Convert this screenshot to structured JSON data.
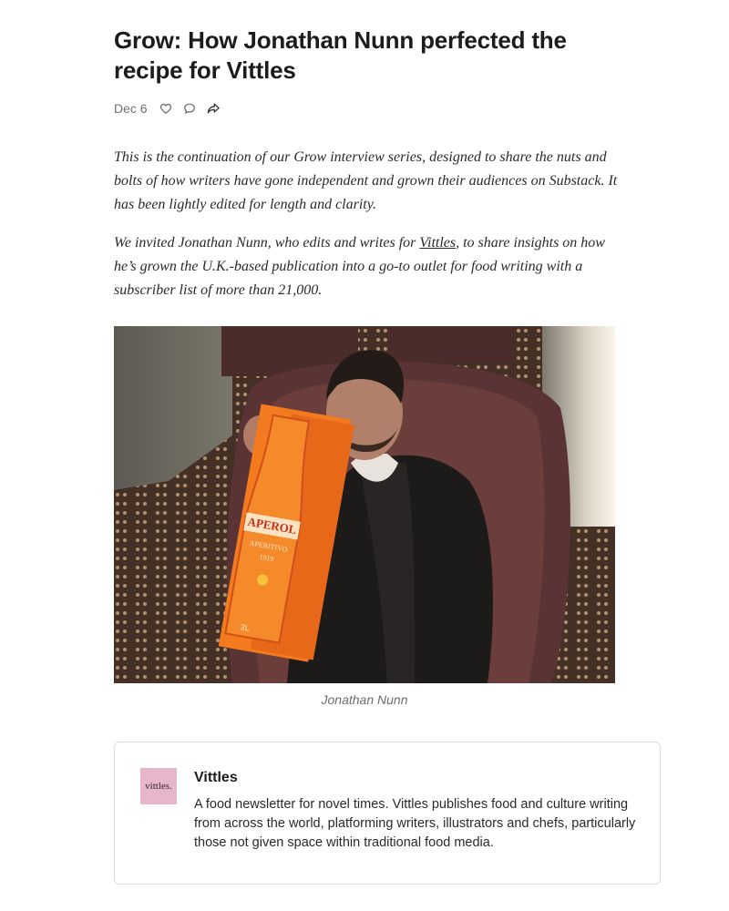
{
  "article": {
    "title": "Grow: How Jonathan Nunn perfected the recipe for Vittles",
    "date": "Dec 6",
    "intro_paragraph_1": "This is the continuation of our Grow interview series, designed to share the nuts and bolts of how writers have gone independent and grown their audiences on Substack. It has been lightly edited for length and clarity.",
    "intro_paragraph_2_before": "We invited Jonathan Nunn, who edits and writes for ",
    "intro_link": "Vittles",
    "intro_paragraph_2_after": ", to share insights on how he’s grown the U.K.-based publication into a go-to outlet for food writing with a subscriber list of more than 21,000.",
    "image_caption": "Jonathan Nunn"
  },
  "photo": {
    "bottle_brand": "APEROL",
    "bottle_sub": "APERITIVO",
    "bottle_year": "1919",
    "bottle_size": "3L"
  },
  "icons": {
    "like": "heart-icon",
    "comment": "comment-icon",
    "share": "share-icon"
  },
  "embed": {
    "logo_text": "vittles.",
    "name": "Vittles",
    "description": "A food newsletter for novel times. Vittles publishes food and culture writing from across the world, platforming writers, illustrators and chefs, particularly those not given space within traditional food media."
  },
  "colors": {
    "logo_bg": "#e7b6cc",
    "bottle_orange": "#f47a1f"
  }
}
